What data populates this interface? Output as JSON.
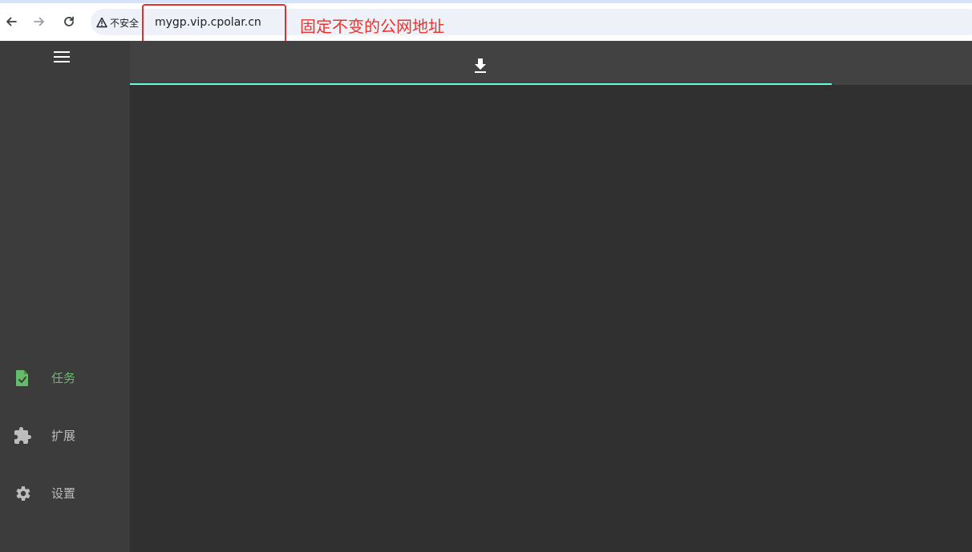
{
  "browser": {
    "back_icon": "arrow-left-icon",
    "forward_icon": "arrow-right-icon",
    "reload_icon": "reload-icon",
    "security_label": "不安全",
    "url": "mygp.vip.cpolar.cn"
  },
  "annotation": {
    "text": "固定不变的公网地址",
    "color": "#e8342c"
  },
  "sidebar": {
    "menu_icon": "hamburger-menu-icon",
    "items": [
      {
        "label": "任务",
        "icon": "task-file-icon",
        "active": true,
        "color": "#66bb6a"
      },
      {
        "label": "扩展",
        "icon": "puzzle-icon",
        "active": false,
        "color": "#bdbdbd"
      },
      {
        "label": "设置",
        "icon": "gear-icon",
        "active": false,
        "color": "#bdbdbd"
      }
    ]
  },
  "tabs": [
    {
      "icon": "download-icon",
      "active": true,
      "indicator_color": "#64ffda"
    }
  ],
  "colors": {
    "background": "#303030",
    "sidebar": "#3c3c3c",
    "header": "#424242",
    "accent": "#64ffda"
  }
}
